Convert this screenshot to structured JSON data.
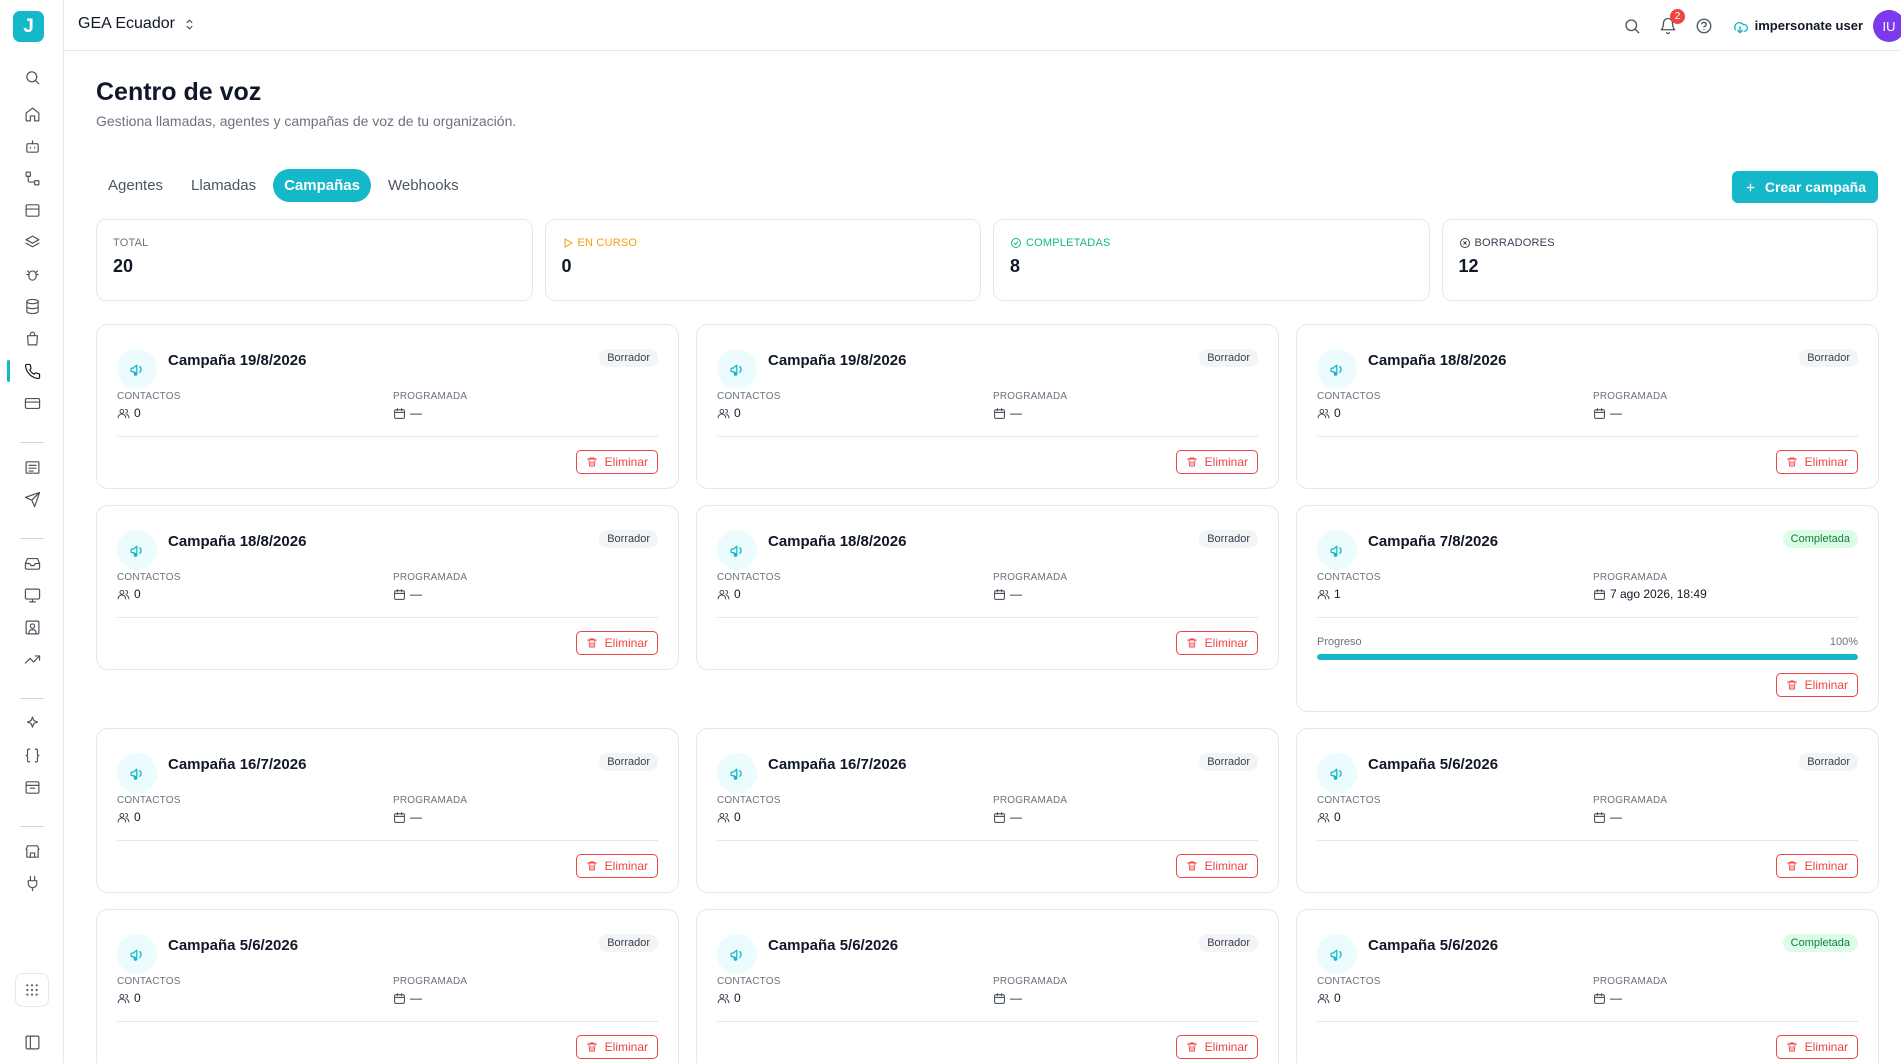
{
  "app": {
    "logo_letter": "J"
  },
  "header": {
    "org_name": "GEA Ecuador",
    "notifications_count": "2",
    "user_name": "impersonate user",
    "avatar_initials": "IU"
  },
  "sidebar": {
    "icons": [
      "search-icon",
      "home-icon",
      "bot-icon",
      "workflow-icon",
      "archive-icon",
      "layers-icon",
      "bug-icon",
      "database-icon",
      "shopping-bag-icon",
      "phone-icon",
      "credit-card-icon",
      "list-icon",
      "send-icon",
      "inbox-icon",
      "monitor-icon",
      "contact-icon",
      "trending-up-icon",
      "sparkles-icon",
      "braces-icon",
      "package-icon",
      "store-icon",
      "plug-icon",
      "grid-icon",
      "sidebar-toggle-icon"
    ],
    "active": "phone-icon"
  },
  "page": {
    "title": "Centro de voz",
    "subtitle": "Gestiona llamadas, agentes y campañas de voz de tu organización."
  },
  "tabs": [
    {
      "label": "Agentes",
      "active": false
    },
    {
      "label": "Llamadas",
      "active": false
    },
    {
      "label": "Campañas",
      "active": true
    },
    {
      "label": "Webhooks",
      "active": false
    }
  ],
  "actions": {
    "create_label": "Crear campaña"
  },
  "stats": {
    "total_label": "TOTAL",
    "total_value": "20",
    "running_label": "EN CURSO",
    "running_value": "0",
    "completed_label": "COMPLETADAS",
    "completed_value": "8",
    "drafts_label": "BORRADORES",
    "drafts_value": "12"
  },
  "card_labels": {
    "contacts": "CONTACTOS",
    "scheduled": "PROGRAMADA",
    "progress": "Progreso",
    "delete": "Eliminar"
  },
  "campaigns": [
    {
      "name": "Campaña 19/8/2026",
      "status": "Borrador",
      "contacts": "0",
      "scheduled": "—"
    },
    {
      "name": "Campaña 19/8/2026",
      "status": "Borrador",
      "contacts": "0",
      "scheduled": "—"
    },
    {
      "name": "Campaña 18/8/2026",
      "status": "Borrador",
      "contacts": "0",
      "scheduled": "—"
    },
    {
      "name": "Campaña 18/8/2026",
      "status": "Borrador",
      "contacts": "0",
      "scheduled": "—"
    },
    {
      "name": "Campaña 18/8/2026",
      "status": "Borrador",
      "contacts": "0",
      "scheduled": "—"
    },
    {
      "name": "Campaña 7/8/2026",
      "status": "Completada",
      "contacts": "1",
      "scheduled": "7 ago 2026, 18:49",
      "progress": 1.0,
      "progress_text": "100%"
    },
    {
      "name": "Campaña 16/7/2026",
      "status": "Borrador",
      "contacts": "0",
      "scheduled": "—"
    },
    {
      "name": "Campaña 16/7/2026",
      "status": "Borrador",
      "contacts": "0",
      "scheduled": "—"
    },
    {
      "name": "Campaña 5/6/2026",
      "status": "Borrador",
      "contacts": "0",
      "scheduled": "—"
    },
    {
      "name": "Campaña 5/6/2026",
      "status": "Borrador",
      "contacts": "0",
      "scheduled": "—"
    },
    {
      "name": "Campaña 5/6/2026",
      "status": "Borrador",
      "contacts": "0",
      "scheduled": "—"
    },
    {
      "name": "Campaña 5/6/2026",
      "status": "Completada",
      "contacts": "0",
      "scheduled": "—"
    }
  ],
  "colors": {
    "accent": "#14b8c8",
    "danger": "#ef4444",
    "success": "#15803d",
    "warning": "#f59e0b"
  }
}
